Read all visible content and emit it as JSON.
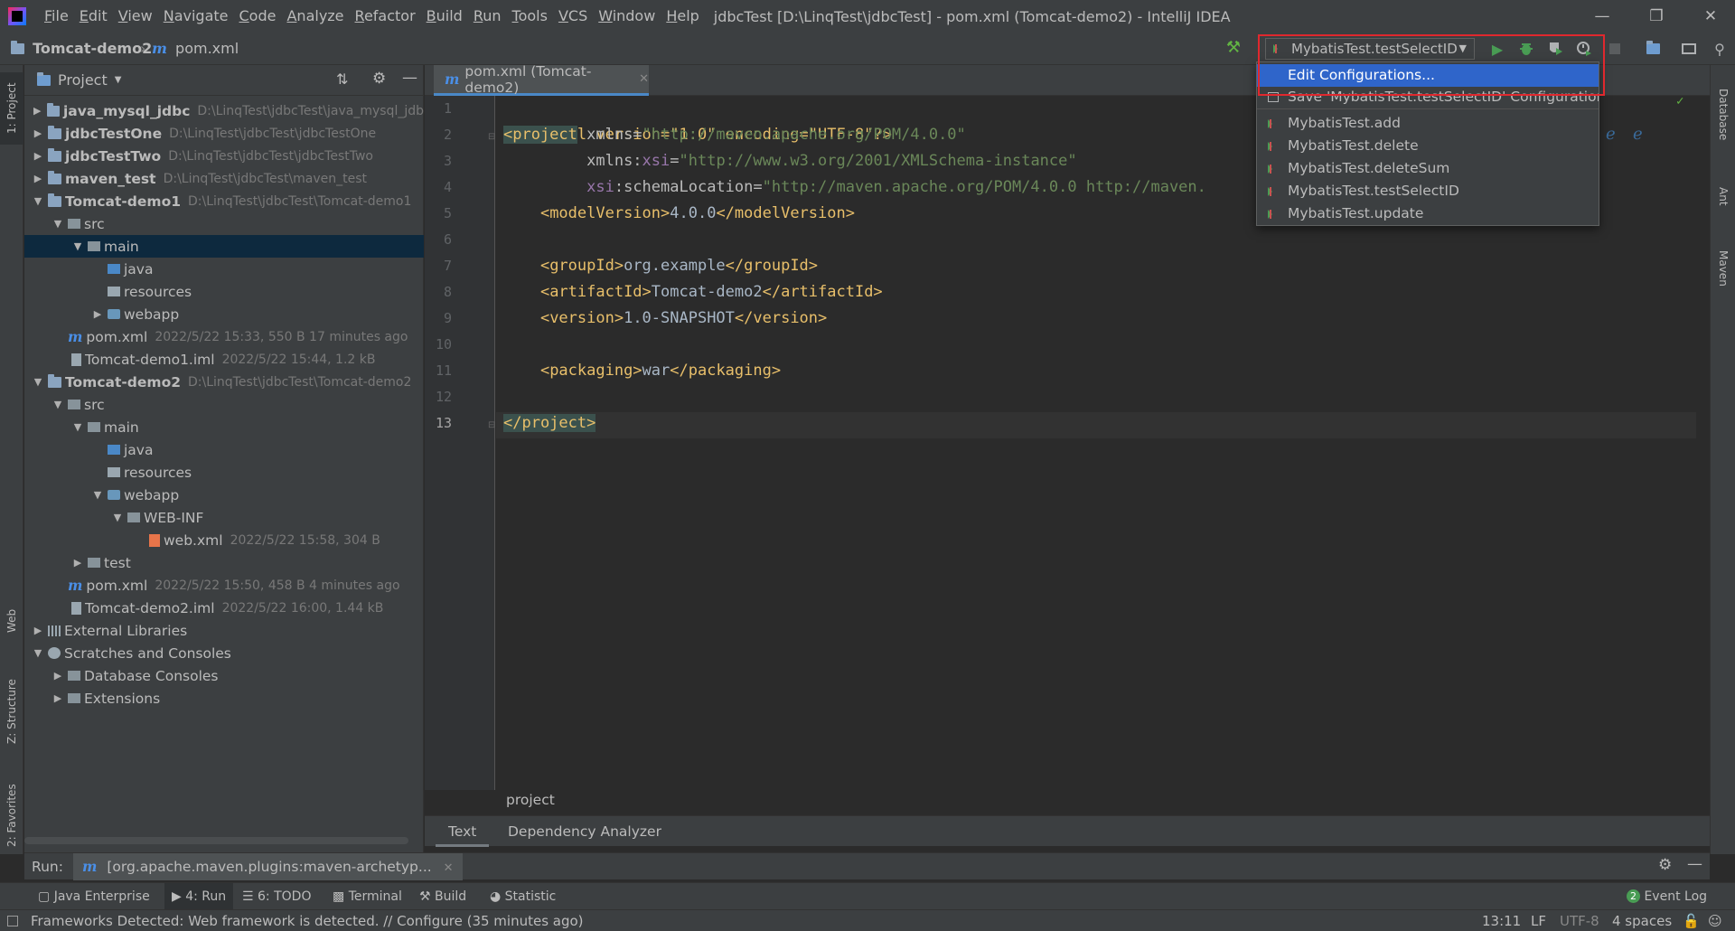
{
  "app": {
    "window_title": "jdbcTest [D:\\LinqTest\\jdbcTest] - pom.xml (Tomcat-demo2) - IntelliJ IDEA",
    "menu": [
      "File",
      "Edit",
      "View",
      "Navigate",
      "Code",
      "Analyze",
      "Refactor",
      "Build",
      "Run",
      "Tools",
      "VCS",
      "Window",
      "Help"
    ]
  },
  "navbar": {
    "project": "Tomcat-demo2",
    "file": "pom.xml"
  },
  "run_config": {
    "selected": "MybatisTest.testSelectID",
    "popup": {
      "edit": "Edit Configurations...",
      "save": "Save 'MybatisTest.testSelectID' Configuration",
      "items": [
        "MybatisTest.add",
        "MybatisTest.delete",
        "MybatisTest.deleteSum",
        "MybatisTest.testSelectID",
        "MybatisTest.update"
      ]
    }
  },
  "left_strip": {
    "project": "1: Project",
    "web": "Web",
    "structure": "Z: Structure",
    "favorites": "2: Favorites"
  },
  "right_strip": {
    "database": "Database",
    "ant": "Ant",
    "maven": "Maven"
  },
  "project_panel": {
    "title": "Project",
    "tree": [
      {
        "name": "java_mysql_jdbc",
        "hint": "D:\\LinqTest\\jdbcTest\\java_mysql_jdb",
        "bold": true
      },
      {
        "name": "jdbcTestOne",
        "hint": "D:\\LinqTest\\jdbcTest\\jdbcTestOne",
        "bold": true
      },
      {
        "name": "jdbcTestTwo",
        "hint": "D:\\LinqTest\\jdbcTest\\jdbcTestTwo",
        "bold": true
      },
      {
        "name": "maven_test",
        "hint": "D:\\LinqTest\\jdbcTest\\maven_test",
        "bold": true
      },
      {
        "name": "Tomcat-demo1",
        "hint": "D:\\LinqTest\\jdbcTest\\Tomcat-demo1",
        "bold": true
      },
      {
        "name": "src",
        "hint": ""
      },
      {
        "name": "main",
        "hint": ""
      },
      {
        "name": "java",
        "hint": ""
      },
      {
        "name": "resources",
        "hint": ""
      },
      {
        "name": "webapp",
        "hint": ""
      },
      {
        "name": "pom.xml",
        "hint": "2022/5/22 15:33, 550 B 17 minutes ago"
      },
      {
        "name": "Tomcat-demo1.iml",
        "hint": "2022/5/22 15:44, 1.2 kB"
      },
      {
        "name": "Tomcat-demo2",
        "hint": "D:\\LinqTest\\jdbcTest\\Tomcat-demo2",
        "bold": true
      },
      {
        "name": "src",
        "hint": ""
      },
      {
        "name": "main",
        "hint": ""
      },
      {
        "name": "java",
        "hint": ""
      },
      {
        "name": "resources",
        "hint": ""
      },
      {
        "name": "webapp",
        "hint": ""
      },
      {
        "name": "WEB-INF",
        "hint": ""
      },
      {
        "name": "web.xml",
        "hint": "2022/5/22 15:58, 304 B"
      },
      {
        "name": "test",
        "hint": ""
      },
      {
        "name": "pom.xml",
        "hint": "2022/5/22 15:50, 458 B 4 minutes ago"
      },
      {
        "name": "Tomcat-demo2.iml",
        "hint": "2022/5/22 16:00, 1.44 kB"
      },
      {
        "name": "External Libraries",
        "hint": ""
      },
      {
        "name": "Scratches and Consoles",
        "hint": ""
      },
      {
        "name": "Database Consoles",
        "hint": ""
      },
      {
        "name": "Extensions",
        "hint": ""
      }
    ]
  },
  "editor": {
    "tab": "pom.xml (Tomcat-demo2)",
    "line_numbers": [
      "1",
      "2",
      "3",
      "4",
      "5",
      "6",
      "7",
      "8",
      "9",
      "10",
      "11",
      "12",
      "13"
    ],
    "code": {
      "l1_decl": "<?xml version=\"1.0\" encoding=\"UTF-8\"?>",
      "l2_open": "<project",
      "l2_attr": " xmlns=",
      "l2_val": "\"http://maven.apache.org/POM/4.0.0\"",
      "l3_attr": "xmlns:",
      "l3_ns": "xsi",
      "l3_eq": "=",
      "l3_val": "\"http://www.w3.org/2001/XMLSchema-instance\"",
      "l4_ns": "xsi",
      "l4_attr": ":schemaLocation=",
      "l4_val": "\"http://maven.apache.org/POM/4.0.0 http://maven.",
      "l5_open": "<modelVersion>",
      "l5_text": "4.0.0",
      "l5_close": "</modelVersion>",
      "l7_open": "<groupId>",
      "l7_text": "org.example",
      "l7_close": "</groupId>",
      "l8_open": "<artifactId>",
      "l8_text": "Tomcat-demo2",
      "l8_close": "</artifactId>",
      "l9_open": "<version>",
      "l9_text": "1.0-SNAPSHOT",
      "l9_close": "</version>",
      "l11_open": "<packaging>",
      "l11_text": "war",
      "l11_close": "</packaging>",
      "l13_close": "</project>"
    },
    "breadcrumb": "project",
    "bottom_tabs": [
      "Text",
      "Dependency Analyzer"
    ]
  },
  "run_panel": {
    "label": "Run:",
    "tab": "[org.apache.maven.plugins:maven-archetyp..."
  },
  "bottom_tools": [
    "Java Enterprise",
    "4: Run",
    "6: TODO",
    "Terminal",
    "Build",
    "Statistic"
  ],
  "event_log": {
    "count": "2",
    "label": "Event Log"
  },
  "status": {
    "message": "Frameworks Detected: Web framework is detected. // Configure (35 minutes ago)",
    "position": "13:11",
    "line_sep": "LF",
    "encoding": "UTF-8",
    "indent": "4 spaces"
  },
  "colors": {
    "accent": "#2f65ca",
    "highlight_box": "#e0282e",
    "tag": "#e8bf6a",
    "string": "#6a8759"
  }
}
